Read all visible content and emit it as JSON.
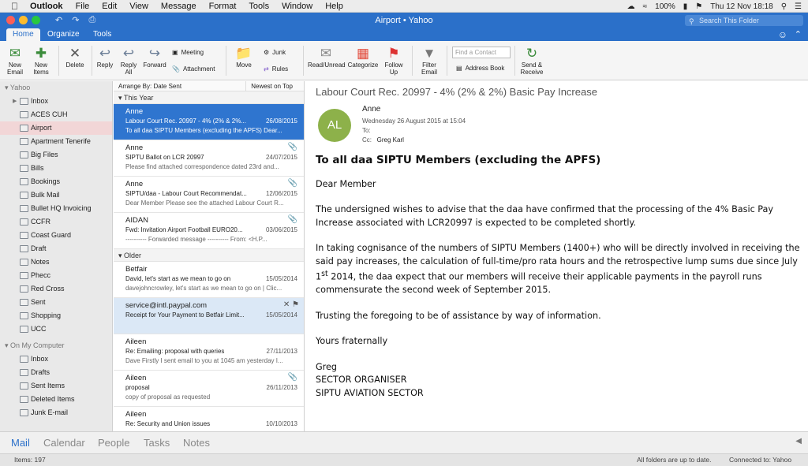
{
  "menubar": {
    "app": "Outlook",
    "items": [
      "File",
      "Edit",
      "View",
      "Message",
      "Format",
      "Tools",
      "Window",
      "Help"
    ],
    "battery": "100%",
    "clock": "Thu 12 Nov  18:18"
  },
  "window": {
    "title": "Airport • Yahoo",
    "search_placeholder": "Search This Folder"
  },
  "tabs": [
    "Home",
    "Organize",
    "Tools"
  ],
  "ribbon": {
    "new_email": "New\nEmail",
    "new_items": "New\nItems",
    "delete": "Delete",
    "reply": "Reply",
    "reply_all": "Reply\nAll",
    "forward": "Forward",
    "meeting": "Meeting",
    "attachment": "Attachment",
    "move": "Move",
    "junk": "Junk",
    "rules": "Rules",
    "read_unread": "Read/Unread",
    "categorize": "Categorize",
    "follow_up": "Follow\nUp",
    "filter_email": "Filter\nEmail",
    "find_contact_placeholder": "Find a Contact",
    "address_book": "Address Book",
    "send_receive": "Send &\nReceive"
  },
  "sidebar": {
    "account": "Yahoo",
    "folders": [
      "Inbox",
      "ACES CUH",
      "Airport",
      "Apartment Tenerife",
      "Big Files",
      "Bills",
      "Bookings",
      "Bulk Mail",
      "Bullet HQ Invoicing",
      "CCFR",
      "Coast Guard",
      "Draft",
      "Notes",
      "Phecc",
      "Red Cross",
      "Sent",
      "Shopping",
      "UCC"
    ],
    "section2": "On My Computer",
    "local": [
      "Inbox",
      "Drafts",
      "Sent Items",
      "Deleted Items",
      "Junk E-mail"
    ]
  },
  "list": {
    "arrange": "Arrange By: Date Sent",
    "order": "Newest on Top",
    "group1": "This Year",
    "group2": "Older",
    "messages": [
      {
        "from": "Anne",
        "subject": "Labour Court Rec. 20997 - 4% (2% & 2%...",
        "date": "26/08/2015",
        "preview": "To all daa SIPTU Members (excluding the APFS) Dear..."
      },
      {
        "from": "Anne",
        "subject": "SIPTU Ballot on LCR 20997",
        "date": "24/07/2015",
        "preview": "Please find attached correspondence dated 23rd and..."
      },
      {
        "from": "Anne",
        "subject": "SIPTU/daa - Labour Court Recommendat...",
        "date": "12/06/2015",
        "preview": "Dear Member Please see the attached Labour Court R..."
      },
      {
        "from": "AIDAN",
        "subject": "Fwd: Invitation Airport Football EURO20...",
        "date": "03/06/2015",
        "preview": "---------- Forwarded message ---------- From: <H.P..."
      },
      {
        "from": "Betfair",
        "subject": "David, let's start as we mean to go on",
        "date": "15/05/2014",
        "preview": "davejohncrowley, let's start as we mean to go on | Clic..."
      },
      {
        "from": "service@intl.paypal.com",
        "subject": "Receipt for Your Payment to Betfair Limit...",
        "date": "15/05/2014",
        "preview": ""
      },
      {
        "from": "Aileen",
        "subject": "Re: Emailing: proposal with queries",
        "date": "27/11/2013",
        "preview": "Dave Firstly I sent email to you at 1045 am yesterday I..."
      },
      {
        "from": "Aileen",
        "subject": "proposal",
        "date": "26/11/2013",
        "preview": "copy of proposal as requested"
      },
      {
        "from": "Aileen",
        "subject": "Re: Security and Union issues",
        "date": "10/10/2013",
        "preview": ""
      }
    ]
  },
  "reading": {
    "subject": "Labour Court Rec. 20997 - 4% (2% & 2%) Basic Pay Increase",
    "initials": "AL",
    "sender": "Anne",
    "date": "Wednesday 26 August 2015 at 15:04",
    "to_label": "To:",
    "cc_label": "Cc:",
    "cc": "Greg   Karl",
    "heading": "To all daa SIPTU Members (excluding the APFS)",
    "greeting": "Dear Member",
    "p1": "The undersigned wishes to advise that the daa have confirmed that the processing of the 4% Basic Pay Increase associated with LCR20997 is expected to be completed shortly.",
    "p2a": "In taking cognisance of the numbers of SIPTU Members (1400+) who will be directly involved in receiving the said pay increases, the calculation of full-time/pro rata hours and the retrospective lump sums due since July 1",
    "p2sup": "st",
    "p2b": " 2014, the daa expect that our members will receive their applicable payments in the payroll runs commensurate the second week of September 2015.",
    "p3": "Trusting the foregoing to be of assistance by way of information.",
    "closing": "Yours fraternally",
    "sig1": "Greg",
    "sig2": "SECTOR ORGANISER",
    "sig3": "SIPTU AVIATION SECTOR"
  },
  "nav": [
    "Mail",
    "Calendar",
    "People",
    "Tasks",
    "Notes"
  ],
  "status": {
    "items": "Items: 197",
    "sync": "All folders are up to date.",
    "connected": "Connected to: Yahoo"
  }
}
